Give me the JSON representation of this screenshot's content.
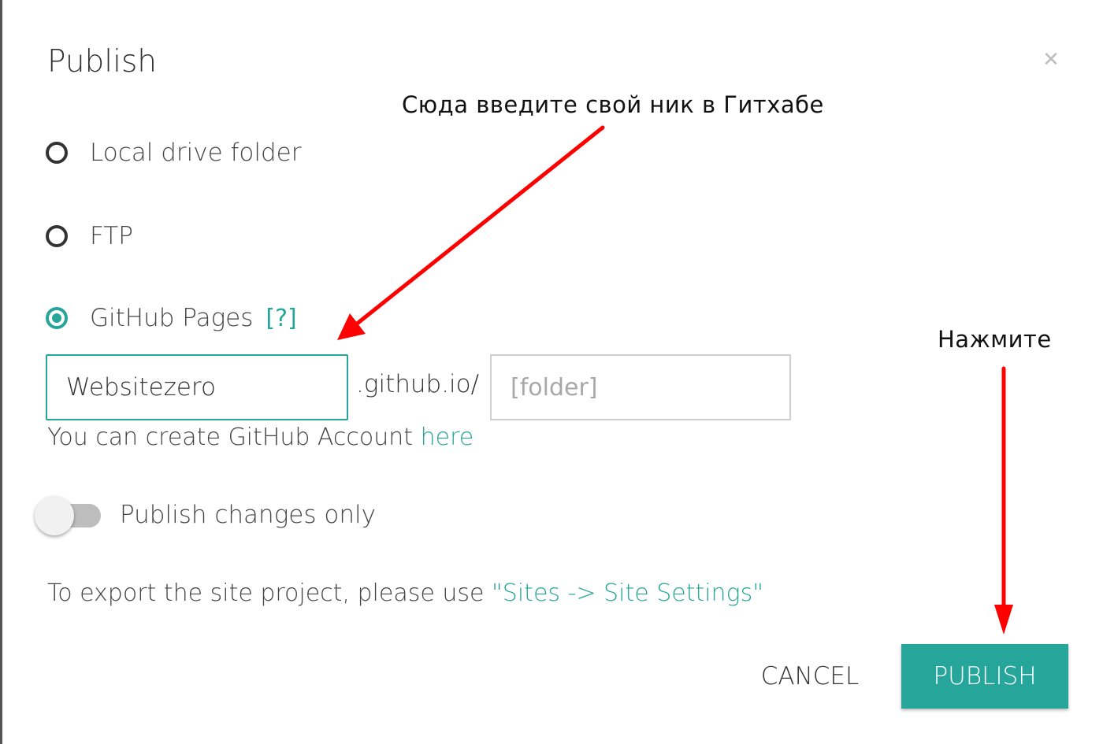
{
  "dialog": {
    "title": "Publish",
    "close_icon": "close-icon"
  },
  "options": [
    {
      "label": "Local drive folder",
      "selected": false
    },
    {
      "label": "FTP",
      "selected": false
    },
    {
      "label": "GitHub Pages",
      "selected": true,
      "help": "[?]"
    }
  ],
  "github": {
    "username_value": "Websitezero",
    "domain_suffix": ".github.io/",
    "folder_placeholder": "[folder]",
    "account_note": "You can create GitHub Account ",
    "account_link": "here"
  },
  "toggle": {
    "label": "Publish changes only",
    "on": false
  },
  "export": {
    "note": "To export the site project, please use ",
    "link": "\"Sites -> Site Settings\""
  },
  "actions": {
    "cancel_label": "CANCEL",
    "publish_label": "PUBLISH"
  },
  "annotations": {
    "username_hint": "Сюда введите свой ник в Гитхабе",
    "publish_hint": "Нажмите"
  },
  "colors": {
    "accent": "#26a69a",
    "annotation_arrow": "#ff0000"
  }
}
